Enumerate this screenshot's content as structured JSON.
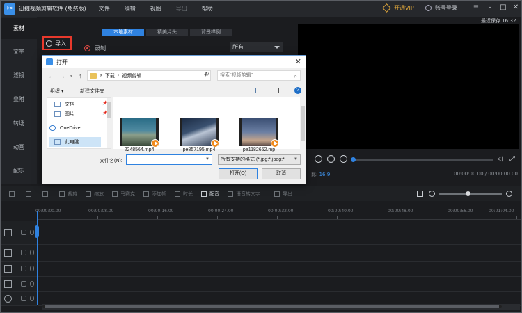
{
  "titlebar": {
    "app_title": "迅捷视频剪辑软件 (免费版)",
    "menu": [
      {
        "label": "文件",
        "enabled": true
      },
      {
        "label": "编辑",
        "enabled": true
      },
      {
        "label": "视图",
        "enabled": true
      },
      {
        "label": "导出",
        "enabled": false
      },
      {
        "label": "帮助",
        "enabled": true
      }
    ],
    "vip_label": "开通VIP",
    "login_label": "账号登录",
    "window_buttons": [
      "menu-icon",
      "minimize-icon",
      "maximize-icon",
      "close-icon"
    ]
  },
  "sidebar": {
    "items": [
      {
        "label": "素材",
        "active": true
      },
      {
        "label": "文字",
        "active": false
      },
      {
        "label": "滤镜",
        "active": false
      },
      {
        "label": "叠附",
        "active": false
      },
      {
        "label": "转场",
        "active": false
      },
      {
        "label": "动画",
        "active": false
      },
      {
        "label": "配乐",
        "active": false
      }
    ]
  },
  "media": {
    "tabs": [
      {
        "label": "本地素材",
        "active": true
      },
      {
        "label": "精美片头",
        "active": false
      },
      {
        "label": "背景样例",
        "active": false
      }
    ],
    "import_label": "导入",
    "record_label": "录制",
    "filter_value": "所有"
  },
  "preview": {
    "last_saved": "最近保存 16:32",
    "ratio_label": "比:",
    "ratio_value": "16:9",
    "timecode": "00:00:00.00 / 00:00:00.00",
    "progress": 0
  },
  "toolbar": {
    "tools": [
      {
        "label": "",
        "icon": "undo-icon",
        "enabled": false
      },
      {
        "label": "",
        "icon": "redo-icon",
        "enabled": false
      },
      {
        "label": "",
        "icon": "delete-icon",
        "enabled": false
      },
      {
        "label": "裁剪",
        "icon": "crop-icon",
        "enabled": false
      },
      {
        "label": "缩放",
        "icon": "zoom-icon",
        "enabled": false
      },
      {
        "label": "马赛克",
        "icon": "mosaic-icon",
        "enabled": false
      },
      {
        "label": "添加帧",
        "icon": "freeze-frame-icon",
        "enabled": false
      },
      {
        "label": "时长",
        "icon": "duration-icon",
        "enabled": false
      },
      {
        "label": "配音",
        "icon": "voiceover-icon",
        "enabled": true
      },
      {
        "label": "语音转文字",
        "icon": "speech-to-text-icon",
        "enabled": false
      },
      {
        "label": "导出",
        "icon": "export-icon",
        "enabled": false
      }
    ],
    "zoom_level": 0.45
  },
  "timeline": {
    "ruler_labels": [
      "00:00:00.00",
      "00:00:08.00",
      "00:00:16.00",
      "00:00:24.00",
      "00:00:32.00",
      "00:00:40.00",
      "00:00:48.00",
      "00:00:56.00",
      "00:01:04.00"
    ],
    "tracks": [
      {
        "name": "video-main",
        "icon": "film-icon"
      },
      {
        "name": "video-overlay",
        "icon": "film-overlay-icon"
      },
      {
        "name": "text",
        "icon": "text-track-icon"
      },
      {
        "name": "music",
        "icon": "music-icon"
      },
      {
        "name": "voice",
        "icon": "microphone-icon"
      }
    ]
  },
  "dialog": {
    "title": "打开",
    "breadcrumb": [
      "下载",
      "视频剪辑"
    ],
    "search_placeholder": "搜索\"视频剪辑\"",
    "organize_label": "组织 ▾",
    "new_folder_label": "新建文件夹",
    "nav_items": [
      {
        "label": "文档",
        "pinned": true,
        "selected": false
      },
      {
        "label": "图片",
        "pinned": true,
        "selected": false
      },
      {
        "label": "OneDrive",
        "pinned": false,
        "selected": false
      },
      {
        "label": "此电脑",
        "pinned": false,
        "selected": true
      }
    ],
    "files": [
      {
        "name": "2248564.mp4",
        "colors": [
          "#2a6c86",
          "#8b9e8a"
        ]
      },
      {
        "name": "pe857195.mp4",
        "colors": [
          "#1c2c44",
          "#b9c4d4"
        ]
      },
      {
        "name": "pe1182652.mp",
        "colors": [
          "#3b4f73",
          "#c4a48a"
        ]
      }
    ],
    "filename_label": "文件名(N):",
    "filename_value": "",
    "filetype_value": "所有支持的格式 (*.jpg;*.jpeg;*",
    "open_label": "打开(O)",
    "cancel_label": "取消"
  }
}
